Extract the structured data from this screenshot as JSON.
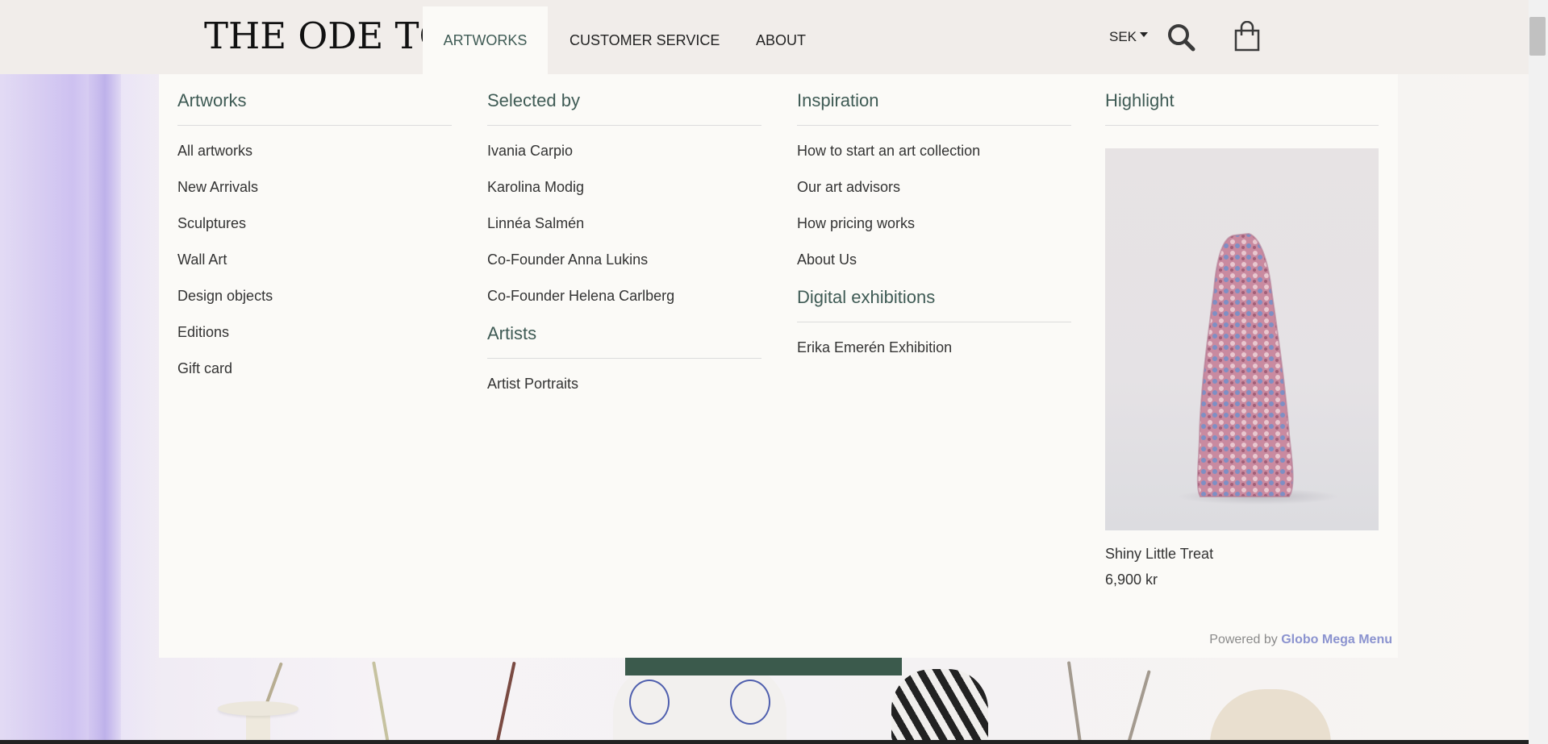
{
  "header": {
    "logo": "THE ODE TO",
    "nav": [
      "ARTWORKS",
      "CUSTOMER SERVICE",
      "ABOUT"
    ],
    "currency": "SEK",
    "icons": [
      "search-icon",
      "cart-icon"
    ]
  },
  "menu": {
    "artworks": {
      "title": "Artworks",
      "links": [
        "All artworks",
        "New Arrivals",
        "Sculptures",
        "Wall Art",
        "Design objects",
        "Editions",
        "Gift card"
      ]
    },
    "selected_by": {
      "title": "Selected by",
      "links": [
        "Ivania Carpio",
        "Karolina Modig",
        "Linnéa Salmén",
        "Co-Founder Anna Lukins",
        "Co-Founder Helena Carlberg"
      ]
    },
    "artists": {
      "title": "Artists",
      "links": [
        "Artist Portraits"
      ]
    },
    "inspiration": {
      "title": "Inspiration",
      "links": [
        "How to start an art collection",
        "Our art advisors",
        "How pricing works",
        "About Us"
      ]
    },
    "digital_exhibitions": {
      "title": "Digital exhibitions",
      "links": [
        "Erika Emerén Exhibition"
      ]
    },
    "highlight": {
      "title": "Highlight",
      "product_name": "Shiny Little Treat",
      "product_price": "6,900 kr"
    },
    "powered_by": {
      "prefix": "Powered by ",
      "brand": "Globo Mega Menu"
    }
  },
  "colors": {
    "accent": "#3f5b55",
    "header_bg": "#f1edea",
    "menu_bg": "#fbfaf7",
    "brand_link": "#8b93cf"
  }
}
